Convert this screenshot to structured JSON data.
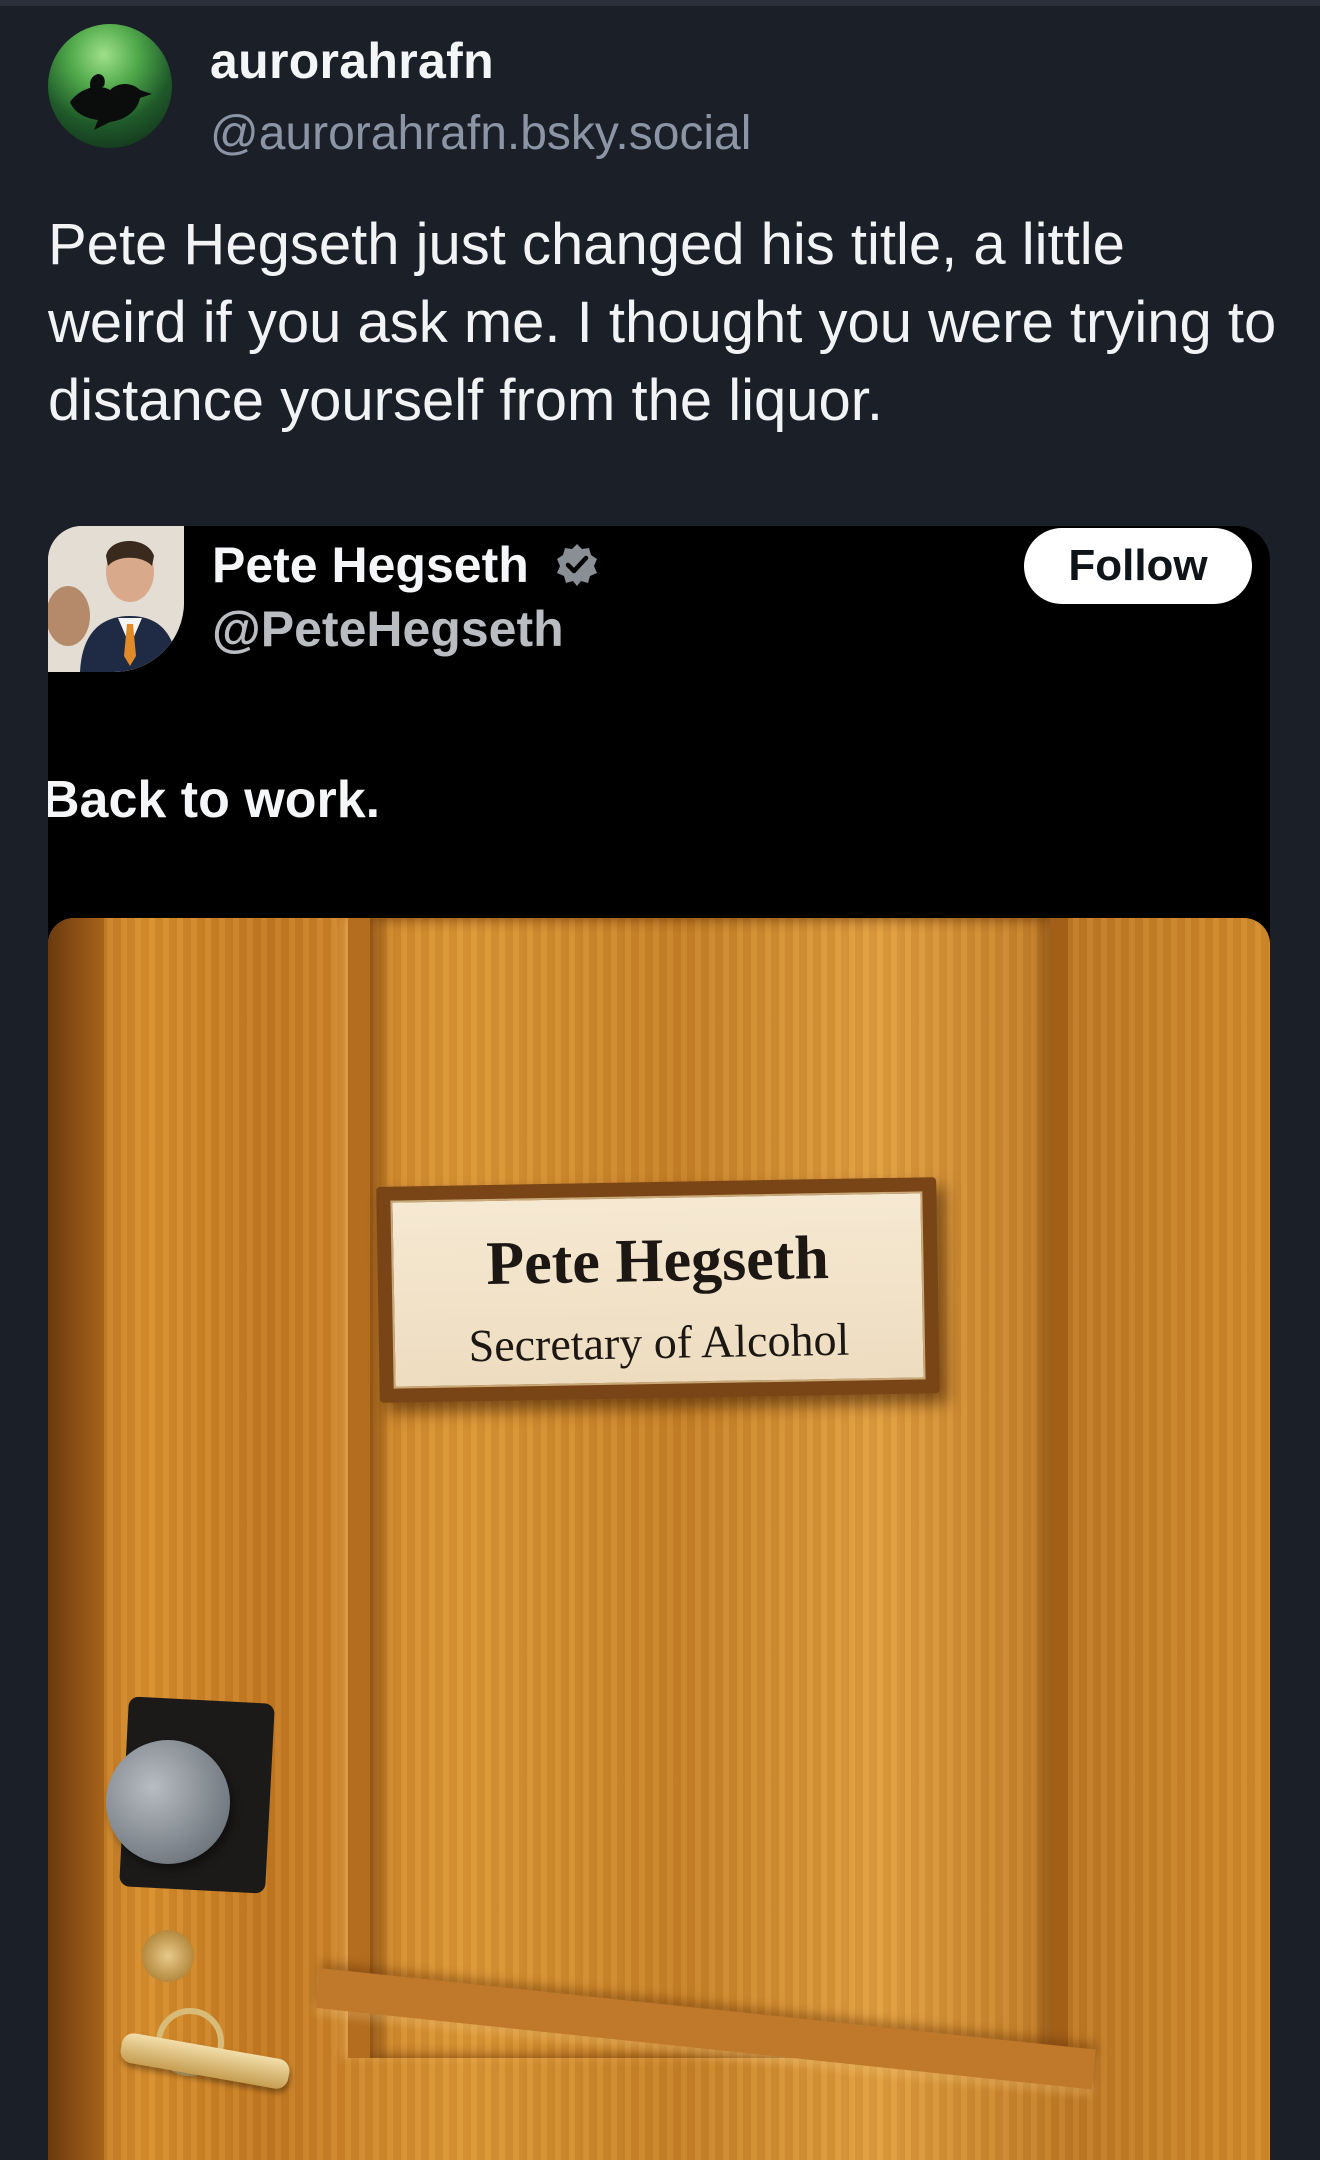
{
  "post": {
    "author": {
      "display_name": "aurorahrafn",
      "handle": "@aurorahrafn.bsky.social",
      "avatar_icon": "raven-aurora-avatar"
    },
    "text": "Pete Hegseth just changed his title, a little weird if you ask me. I thought you were trying to distance yourself from the liquor."
  },
  "embedded_post": {
    "author": {
      "display_name": "Pete Hegseth",
      "handle": "@PeteHegseth",
      "verified_icon": "verified-badge-icon",
      "avatar_icon": "profile-photo-avatar"
    },
    "follow_label": "Follow",
    "text": "Back to work.",
    "image": {
      "description_icon": "office-door-photo",
      "plaque": {
        "name": "Pete Hegseth",
        "title": "Secretary of Alcohol"
      }
    }
  },
  "colors": {
    "background": "#1b1f28",
    "embed_background": "#000000",
    "handle_gray": "#8b95a5",
    "follow_button_bg": "#ffffff"
  }
}
